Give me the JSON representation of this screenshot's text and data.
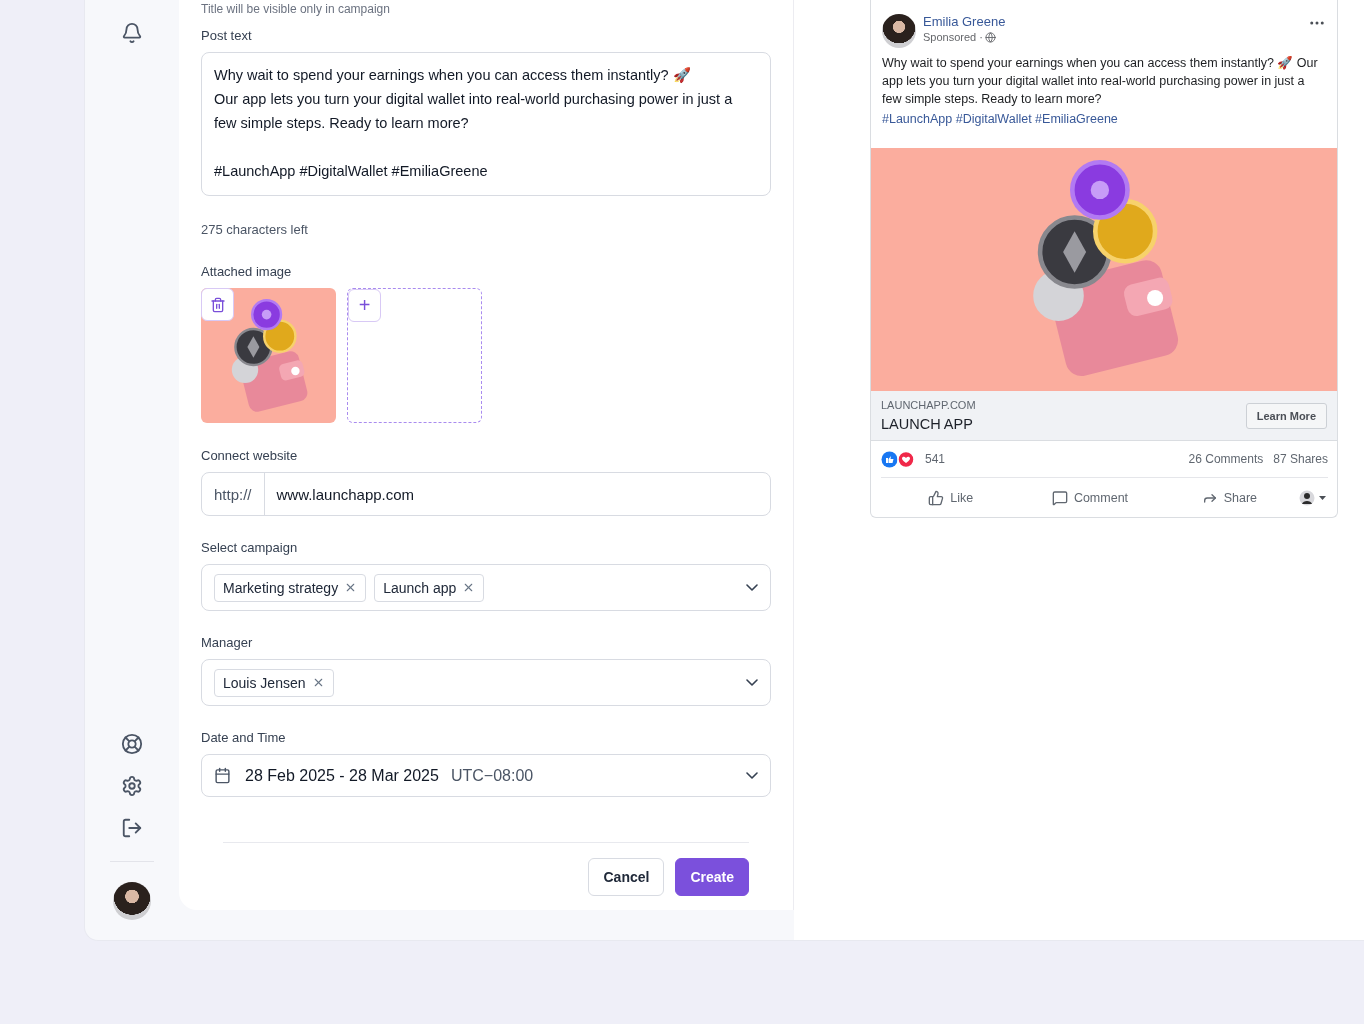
{
  "form": {
    "title_hint": "Title will be visible only in campaign",
    "post_text": {
      "label": "Post text",
      "value": "Why wait to spend your earnings when you can access them instantly? 🚀\nOur app lets you turn your digital wallet into real-world purchasing power in just a few simple steps. Ready to learn more?\n\n#LaunchApp #DigitalWallet #EmiliaGreene"
    },
    "characters_left": "275 characters left",
    "attached_image": {
      "label": "Attached image",
      "add_symbol": "+"
    },
    "website": {
      "label": "Connect website",
      "prefix": "http://",
      "value": "www.launchapp.com"
    },
    "campaign": {
      "label": "Select campaign",
      "tags": [
        "Marketing strategy",
        "Launch app"
      ]
    },
    "manager": {
      "label": "Manager",
      "tags": [
        "Louis Jensen"
      ]
    },
    "date_time": {
      "label": "Date and Time",
      "range": "28 Feb 2025 - 28 Mar 2025",
      "timezone": "UTC−08:00"
    },
    "buttons": [
      {
        "label": "Cancel",
        "kind": "secondary"
      },
      {
        "label": "Create",
        "kind": "primary"
      }
    ]
  },
  "preview": {
    "author": "Emilia Greene",
    "sponsored": "Sponsored ·",
    "text": "Why wait to spend your earnings when you can access them instantly? 🚀 Our app lets you turn your digital wallet into real-world purchasing power in just a few simple steps. Ready to learn more?",
    "hashtags": "#LaunchApp #DigitalWallet #EmiliaGreene",
    "link": {
      "domain": "LAUNCHAPP.COM",
      "title": "LAUNCH APP",
      "button": "Learn More"
    },
    "reactions": "541",
    "comments": "26 Comments",
    "shares": "87 Shares",
    "actions": [
      {
        "label": "Like",
        "kind": "like"
      },
      {
        "label": "Comment",
        "kind": "comment"
      },
      {
        "label": "Share",
        "kind": "share"
      }
    ]
  }
}
